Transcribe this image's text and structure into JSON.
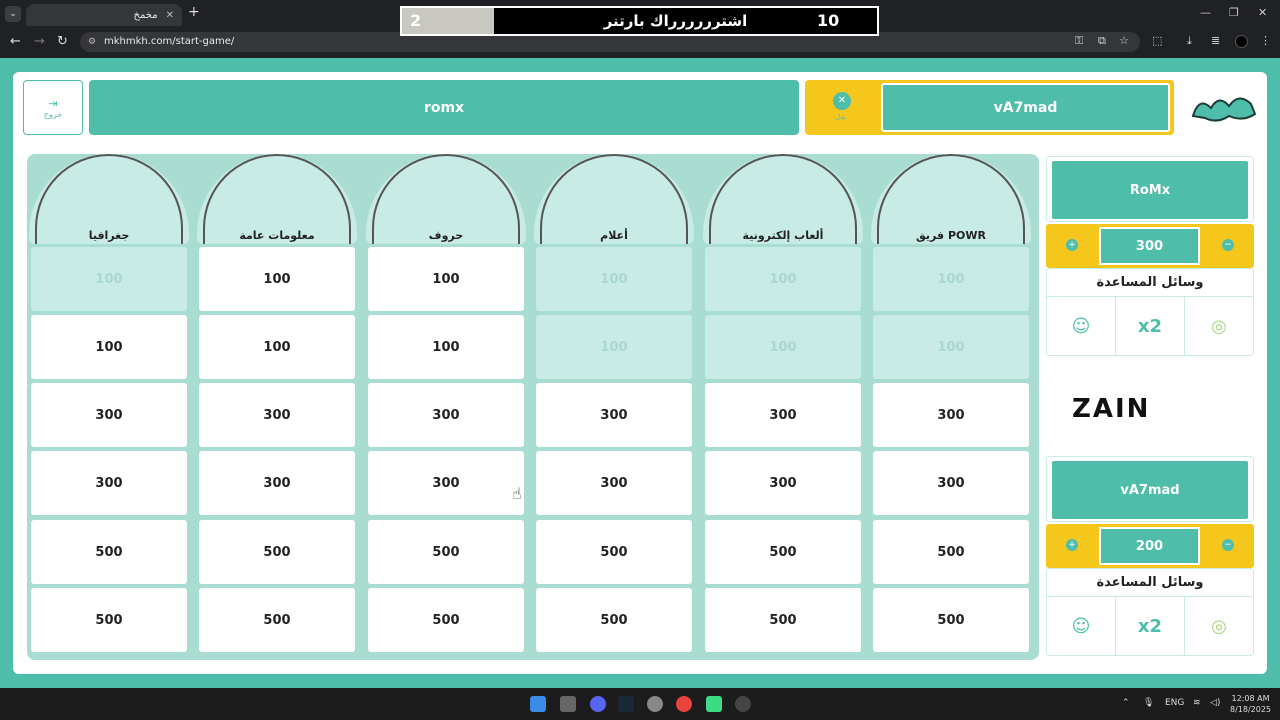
{
  "browser": {
    "tab_title": "مخمخ",
    "url": "mkhmkh.com/start-game/"
  },
  "timer": {
    "player_count": "2",
    "message": "اشترررررراك بارتنر",
    "seconds": "10"
  },
  "header": {
    "exit_label": "خروج",
    "team_left": "romx",
    "team_right": "vA7mad",
    "swap_label": "بدل"
  },
  "categories": [
    {
      "name": "جغرافيا",
      "values": [
        "100",
        "100",
        "300",
        "300",
        "500",
        "500"
      ],
      "used": [
        true,
        false,
        false,
        false,
        false,
        false
      ]
    },
    {
      "name": "معلومات عامة",
      "values": [
        "100",
        "100",
        "300",
        "300",
        "500",
        "500"
      ],
      "used": [
        false,
        false,
        false,
        false,
        false,
        false
      ]
    },
    {
      "name": "حروف",
      "values": [
        "100",
        "100",
        "300",
        "300",
        "500",
        "500"
      ],
      "used": [
        false,
        false,
        false,
        false,
        false,
        false
      ]
    },
    {
      "name": "أعلام",
      "values": [
        "100",
        "100",
        "300",
        "300",
        "500",
        "500"
      ],
      "used": [
        true,
        true,
        false,
        false,
        false,
        false
      ]
    },
    {
      "name": "ألعاب إلكترونية",
      "values": [
        "100",
        "100",
        "300",
        "300",
        "500",
        "500"
      ],
      "used": [
        true,
        true,
        false,
        false,
        false,
        false
      ]
    },
    {
      "name": "فريق POWR",
      "values": [
        "100",
        "100",
        "300",
        "300",
        "500",
        "500"
      ],
      "used": [
        true,
        true,
        false,
        false,
        false,
        false
      ]
    }
  ],
  "teams": [
    {
      "name": "RoMx",
      "score": "300",
      "helps_title": "وسائل المساعدة"
    },
    {
      "name": "vA7mad",
      "score": "200",
      "helps_title": "وسائل المساعدة"
    }
  ],
  "sponsor": "ZAIN",
  "taskbar": {
    "lang": "ENG",
    "time": "12:08 AM",
    "date": "8/18/2025"
  }
}
